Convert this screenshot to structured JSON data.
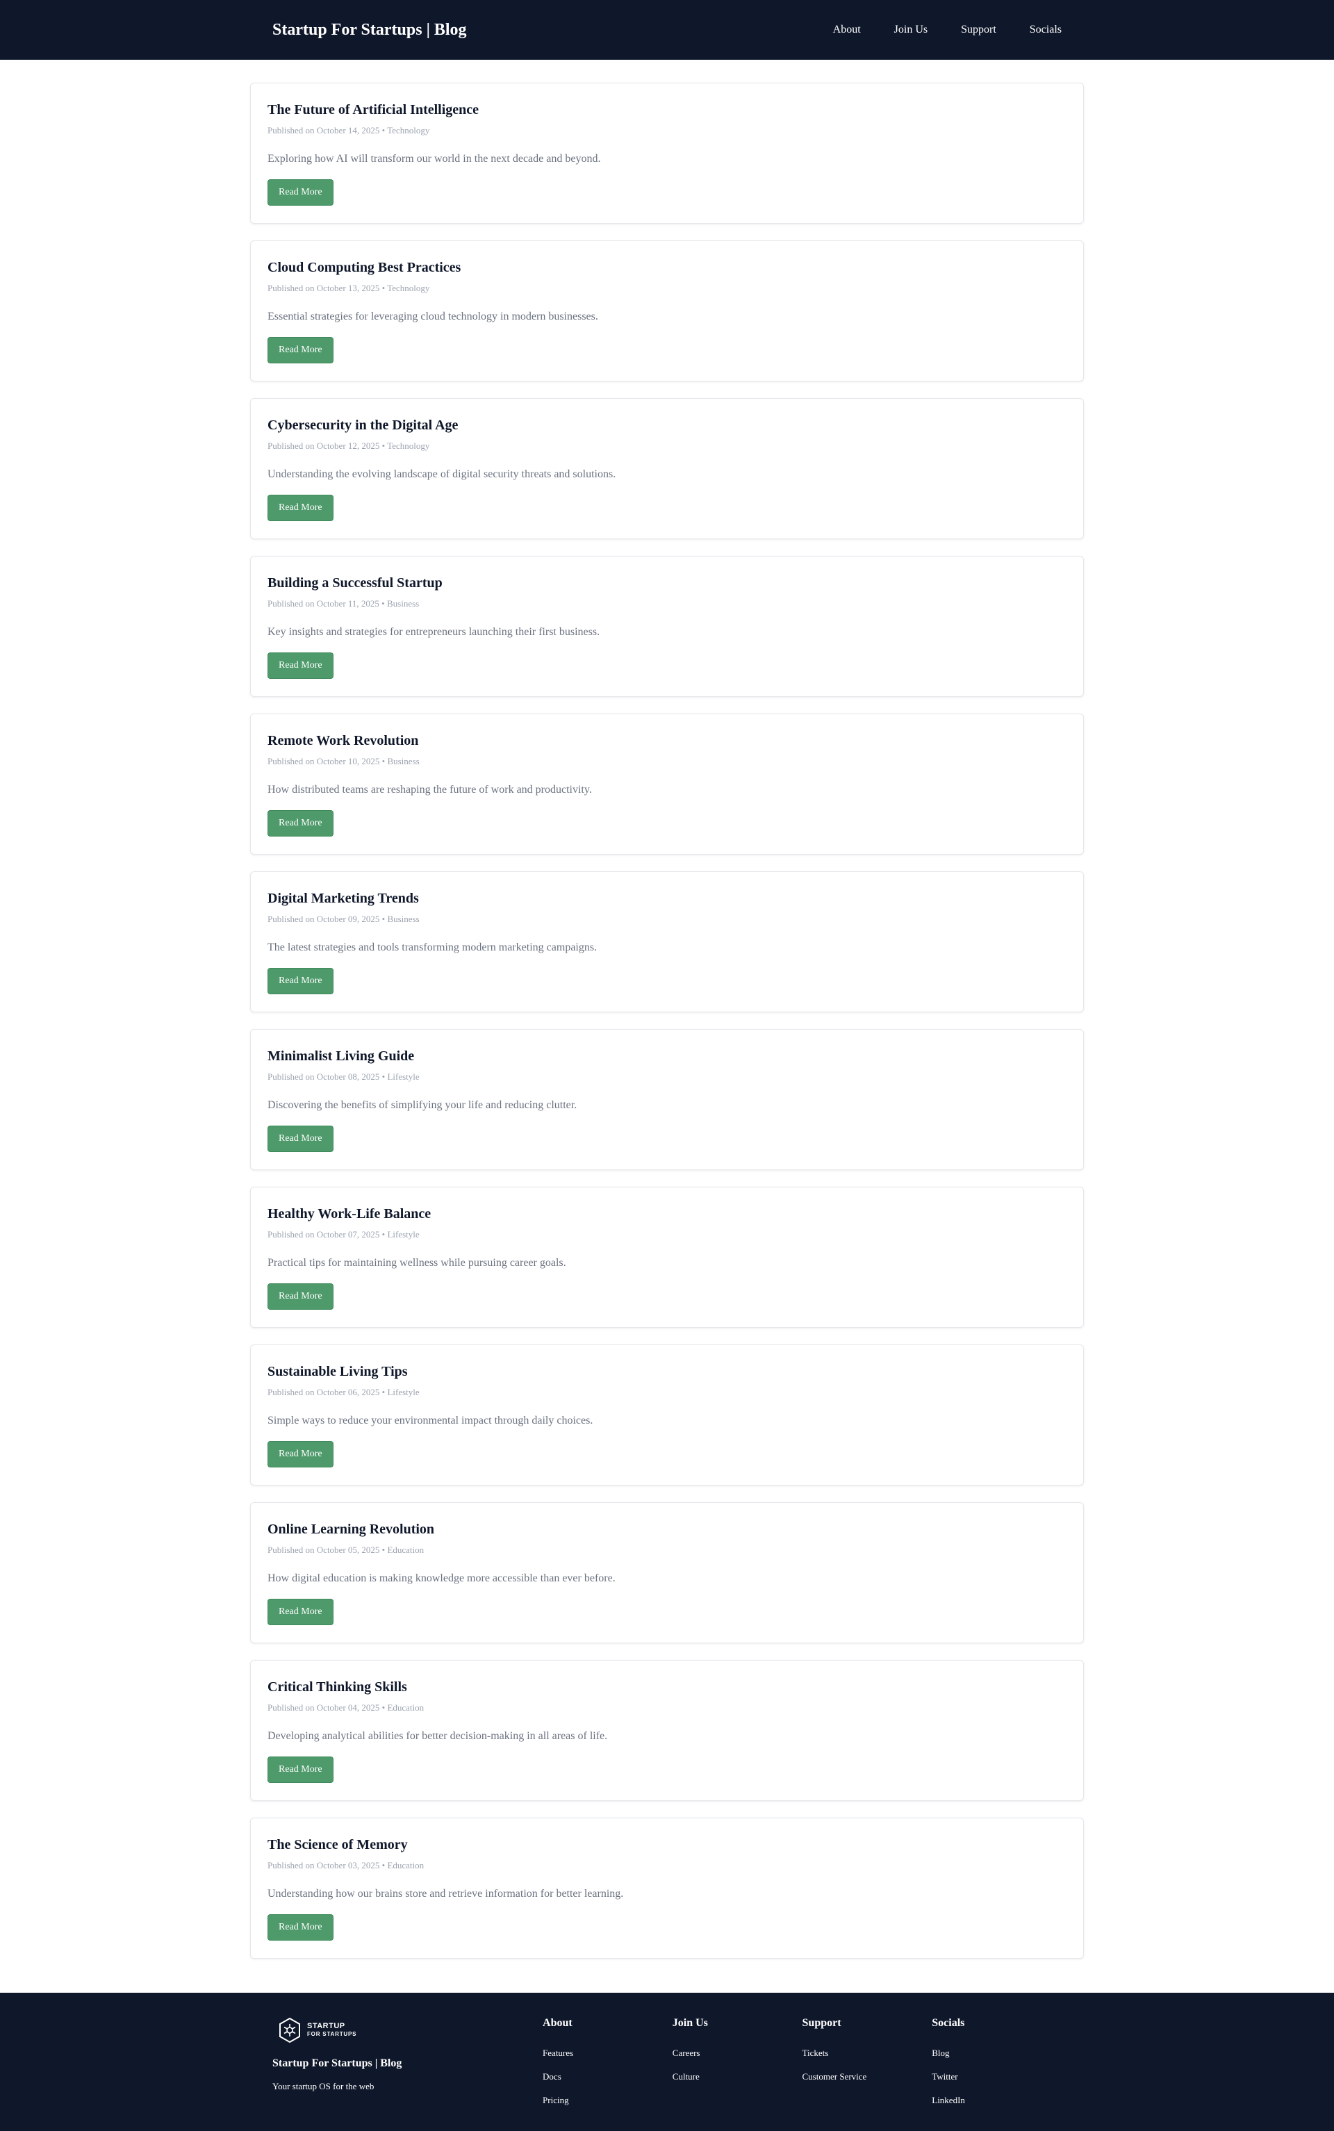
{
  "header": {
    "title": "Startup For Startups | Blog",
    "nav": [
      "About",
      "Join Us",
      "Support",
      "Socials"
    ]
  },
  "posts": [
    {
      "title": "The Future of Artificial Intelligence",
      "meta": "Published on October 14, 2025 • Technology",
      "excerpt": "Exploring how AI will transform our world in the next decade and beyond.",
      "button": "Read More"
    },
    {
      "title": "Cloud Computing Best Practices",
      "meta": "Published on October 13, 2025 • Technology",
      "excerpt": "Essential strategies for leveraging cloud technology in modern businesses.",
      "button": "Read More"
    },
    {
      "title": "Cybersecurity in the Digital Age",
      "meta": "Published on October 12, 2025 • Technology",
      "excerpt": "Understanding the evolving landscape of digital security threats and solutions.",
      "button": "Read More"
    },
    {
      "title": "Building a Successful Startup",
      "meta": "Published on October 11, 2025 • Business",
      "excerpt": "Key insights and strategies for entrepreneurs launching their first business.",
      "button": "Read More"
    },
    {
      "title": "Remote Work Revolution",
      "meta": "Published on October 10, 2025 • Business",
      "excerpt": "How distributed teams are reshaping the future of work and productivity.",
      "button": "Read More"
    },
    {
      "title": "Digital Marketing Trends",
      "meta": "Published on October 09, 2025 • Business",
      "excerpt": "The latest strategies and tools transforming modern marketing campaigns.",
      "button": "Read More"
    },
    {
      "title": "Minimalist Living Guide",
      "meta": "Published on October 08, 2025 • Lifestyle",
      "excerpt": "Discovering the benefits of simplifying your life and reducing clutter.",
      "button": "Read More"
    },
    {
      "title": "Healthy Work-Life Balance",
      "meta": "Published on October 07, 2025 • Lifestyle",
      "excerpt": "Practical tips for maintaining wellness while pursuing career goals.",
      "button": "Read More"
    },
    {
      "title": "Sustainable Living Tips",
      "meta": "Published on October 06, 2025 • Lifestyle",
      "excerpt": "Simple ways to reduce your environmental impact through daily choices.",
      "button": "Read More"
    },
    {
      "title": "Online Learning Revolution",
      "meta": "Published on October 05, 2025 • Education",
      "excerpt": "How digital education is making knowledge more accessible than ever before.",
      "button": "Read More"
    },
    {
      "title": "Critical Thinking Skills",
      "meta": "Published on October 04, 2025 • Education",
      "excerpt": "Developing analytical abilities for better decision-making in all areas of life.",
      "button": "Read More"
    },
    {
      "title": "The Science of Memory",
      "meta": "Published on October 03, 2025 • Education",
      "excerpt": "Understanding how our brains store and retrieve information for better learning.",
      "button": "Read More"
    }
  ],
  "footer": {
    "logo_line1": "STARTUP",
    "logo_line2": "FOR STARTUPS",
    "brand_title": "Startup For Startups | Blog",
    "tagline": "Your startup OS for the web",
    "columns": [
      {
        "title": "About",
        "links": [
          "Features",
          "Docs",
          "Pricing"
        ]
      },
      {
        "title": "Join Us",
        "links": [
          "Careers",
          "Culture"
        ]
      },
      {
        "title": "Support",
        "links": [
          "Tickets",
          "Customer Service"
        ]
      },
      {
        "title": "Socials",
        "links": [
          "Blog",
          "Twitter",
          "LinkedIn"
        ]
      }
    ]
  },
  "colors": {
    "header_bg": "#0f172a",
    "button_bg": "#4e9a6b",
    "title_text": "#0f172a",
    "meta_text": "#9ca3af",
    "excerpt_text": "#6b7280"
  }
}
